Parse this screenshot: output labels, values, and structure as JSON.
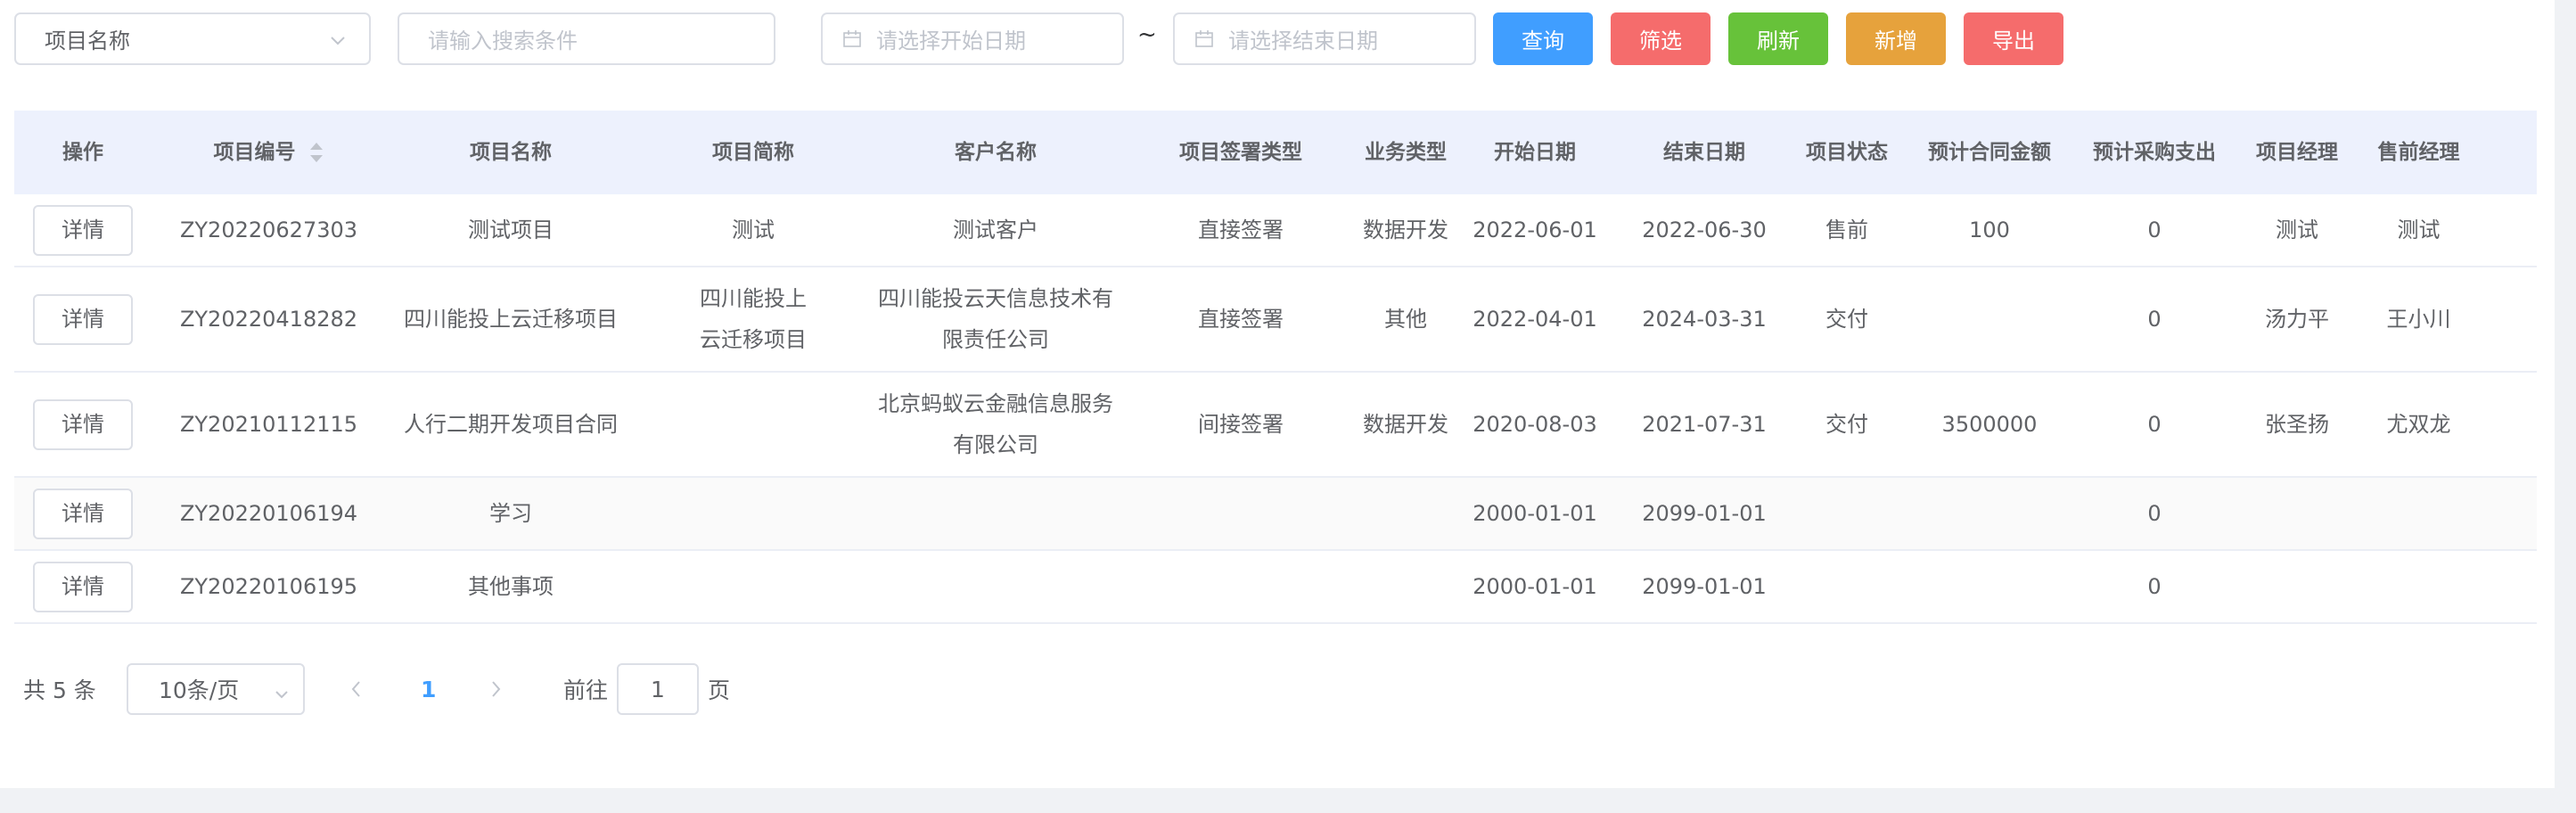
{
  "toolbar": {
    "select_value": "项目名称",
    "search_placeholder": "请输入搜索条件",
    "start_date_placeholder": "请选择开始日期",
    "end_date_placeholder": "请选择结束日期",
    "range_separator": "~",
    "buttons": {
      "query": "查询",
      "filter": "筛选",
      "refresh": "刷新",
      "add": "新增",
      "export": "导出"
    },
    "colors": {
      "query": "#409eff",
      "filter": "#f56c6c",
      "refresh": "#67c23a",
      "add": "#e6a23c",
      "export": "#f56c6c"
    }
  },
  "table": {
    "headers": {
      "op": "操作",
      "no": "项目编号",
      "name": "项目名称",
      "abbr": "项目简称",
      "customer": "客户名称",
      "sign_type": "项目签署类型",
      "biz_type": "业务类型",
      "start": "开始日期",
      "end": "结束日期",
      "status": "项目状态",
      "amount": "预计合同金额",
      "purchase": "预计采购支出",
      "pm": "项目经理",
      "sales": "售前经理"
    },
    "detail_label": "详情",
    "rows": [
      {
        "no": "ZY20220627303",
        "name": "测试项目",
        "abbr": "测试",
        "customer": "测试客户",
        "sign_type": "直接签署",
        "biz_type": "数据开发",
        "start": "2022-06-01",
        "end": "2022-06-30",
        "status": "售前",
        "amount": "100",
        "purchase": "0",
        "pm": "测试",
        "sales": "测试"
      },
      {
        "no": "ZY20220418282",
        "name": "四川能投上云迁移项目",
        "abbr": "四川能投上云迁移项目",
        "customer": "四川能投云天信息技术有限责任公司",
        "sign_type": "直接签署",
        "biz_type": "其他",
        "start": "2022-04-01",
        "end": "2024-03-31",
        "status": "交付",
        "amount": "",
        "purchase": "0",
        "pm": "汤力平",
        "sales": "王小川"
      },
      {
        "no": "ZY20210112115",
        "name": "人行二期开发项目合同",
        "abbr": "",
        "customer": "北京蚂蚁云金融信息服务有限公司",
        "sign_type": "间接签署",
        "biz_type": "数据开发",
        "start": "2020-08-03",
        "end": "2021-07-31",
        "status": "交付",
        "amount": "3500000",
        "purchase": "0",
        "pm": "张圣扬",
        "sales": "尤双龙"
      },
      {
        "no": "ZY20220106194",
        "name": "学习",
        "abbr": "",
        "customer": "",
        "sign_type": "",
        "biz_type": "",
        "start": "2000-01-01",
        "end": "2099-01-01",
        "status": "",
        "amount": "",
        "purchase": "0",
        "pm": "",
        "sales": ""
      },
      {
        "no": "ZY20220106195",
        "name": "其他事项",
        "abbr": "",
        "customer": "",
        "sign_type": "",
        "biz_type": "",
        "start": "2000-01-01",
        "end": "2099-01-01",
        "status": "",
        "amount": "",
        "purchase": "0",
        "pm": "",
        "sales": ""
      }
    ]
  },
  "pagination": {
    "total_text": "共 5 条",
    "page_size": "10条/页",
    "current_page": "1",
    "goto_label": "前往",
    "goto_value": "1",
    "page_unit": "页"
  }
}
